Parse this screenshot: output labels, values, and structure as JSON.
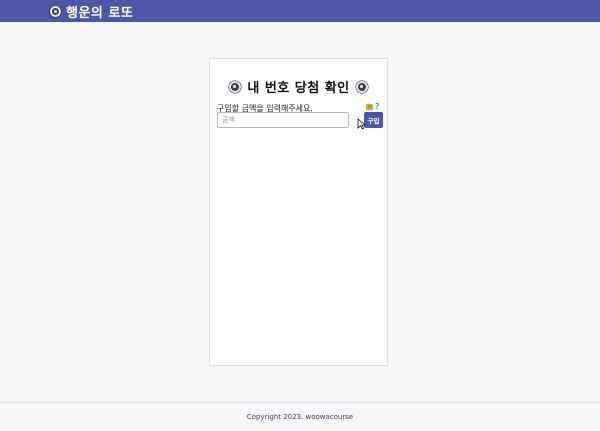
{
  "header": {
    "title": "행운의 로또",
    "icon": "lotto-ball-icon",
    "background": "#4a58a6"
  },
  "card": {
    "title": "내 번호 당첨 확인",
    "amount_label": "구입할 금액을 입력해주세요.",
    "tooltip_label": "?",
    "amount_input": {
      "value": "",
      "placeholder": "금액"
    },
    "buy_label": "구입"
  },
  "footer": {
    "copyright": "Copyright 2023. woowacourse"
  }
}
